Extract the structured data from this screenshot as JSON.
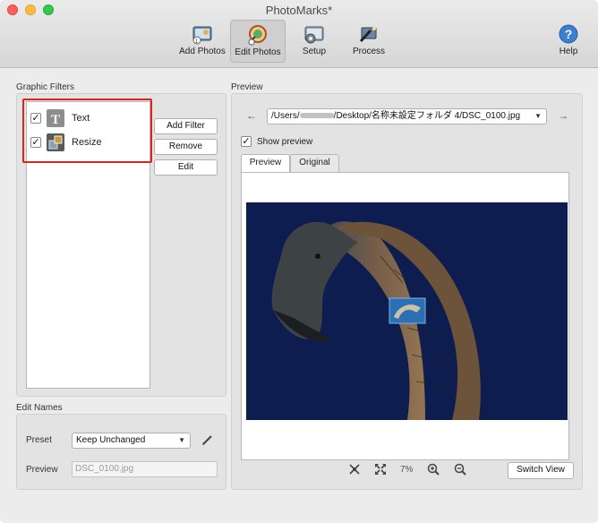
{
  "window": {
    "title": "PhotoMarks*"
  },
  "toolbar": {
    "items": [
      {
        "label": "Add Photos",
        "icon": "add-photos-icon"
      },
      {
        "label": "Edit Photos",
        "icon": "edit-photos-icon"
      },
      {
        "label": "Setup",
        "icon": "setup-icon"
      },
      {
        "label": "Process",
        "icon": "process-icon"
      },
      {
        "label": "Help",
        "icon": "help-icon"
      }
    ]
  },
  "graphic_filters": {
    "title": "Graphic Filters",
    "items": [
      {
        "label": "Text",
        "checked": true,
        "icon": "text-filter-icon",
        "check_glyph": "✓"
      },
      {
        "label": "Resize",
        "checked": true,
        "icon": "resize-filter-icon",
        "check_glyph": "✓"
      }
    ],
    "add_filter": "Add Filter",
    "remove": "Remove",
    "edit": "Edit"
  },
  "edit_names": {
    "title": "Edit Names",
    "preset_label": "Preset",
    "preset_value": "Keep Unchanged",
    "preview_label": "Preview",
    "preview_value": "DSC_0100.jpg"
  },
  "preview": {
    "title": "Preview",
    "path_user": "/Users/",
    "path_rest": "/Desktop/名称未設定フォルダ 4/DSC_0100.jpg",
    "show_preview_label": "Show preview",
    "show_preview_checked": true,
    "show_preview_glyph": "✓",
    "tabs": [
      "Preview",
      "Original"
    ],
    "zoom": "7%",
    "switch_view": "Switch View"
  },
  "colors": {
    "accent_red": "#d9261c",
    "photo_bg": "#0e1d4f"
  }
}
